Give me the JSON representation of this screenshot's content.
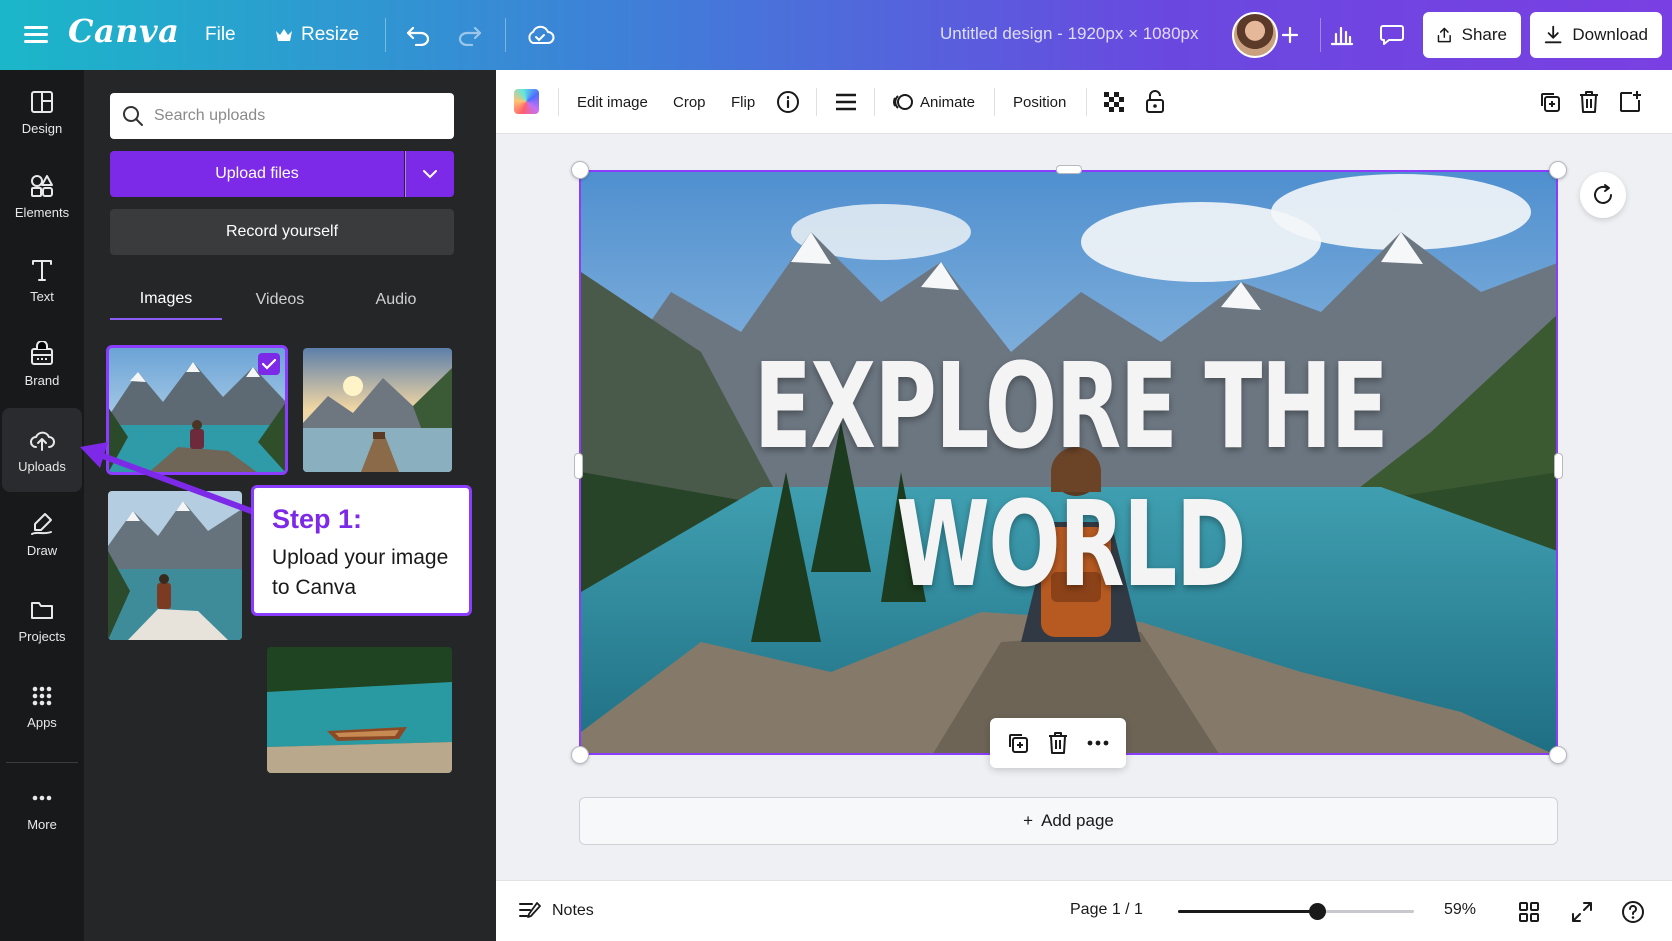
{
  "header": {
    "logo": "Canva",
    "file_label": "File",
    "resize_label": "Resize",
    "doc_title": "Untitled design - 1920px × 1080px",
    "share_label": "Share",
    "download_label": "Download"
  },
  "rail": {
    "items": [
      {
        "label": "Design",
        "icon": "layout-icon"
      },
      {
        "label": "Elements",
        "icon": "shapes-icon"
      },
      {
        "label": "Text",
        "icon": "text-icon"
      },
      {
        "label": "Brand",
        "icon": "brand-icon"
      },
      {
        "label": "Uploads",
        "icon": "cloud-upload-icon"
      },
      {
        "label": "Draw",
        "icon": "pen-icon"
      },
      {
        "label": "Projects",
        "icon": "folder-icon"
      },
      {
        "label": "Apps",
        "icon": "grid-icon"
      },
      {
        "label": "More",
        "icon": "more-icon"
      }
    ],
    "active": "Uploads"
  },
  "panel": {
    "search_placeholder": "Search uploads",
    "upload_label": "Upload files",
    "record_label": "Record yourself",
    "tabs": [
      "Images",
      "Videos",
      "Audio"
    ],
    "active_tab": "Images"
  },
  "callout": {
    "title": "Step 1:",
    "body_line1": "Upload your image",
    "body_line2": "to Canva"
  },
  "toolbar": {
    "edit_image": "Edit image",
    "crop": "Crop",
    "flip": "Flip",
    "animate": "Animate",
    "position": "Position"
  },
  "canvas": {
    "headline": "EXPLORE THE WORLD",
    "add_page": "Add page"
  },
  "footer": {
    "notes": "Notes",
    "page_indicator": "Page 1 / 1",
    "zoom": "59%",
    "zoom_fraction": 0.59
  },
  "colors": {
    "accent": "#7d2ae8",
    "rail_bg": "#18191b",
    "panel_bg": "#252627"
  }
}
